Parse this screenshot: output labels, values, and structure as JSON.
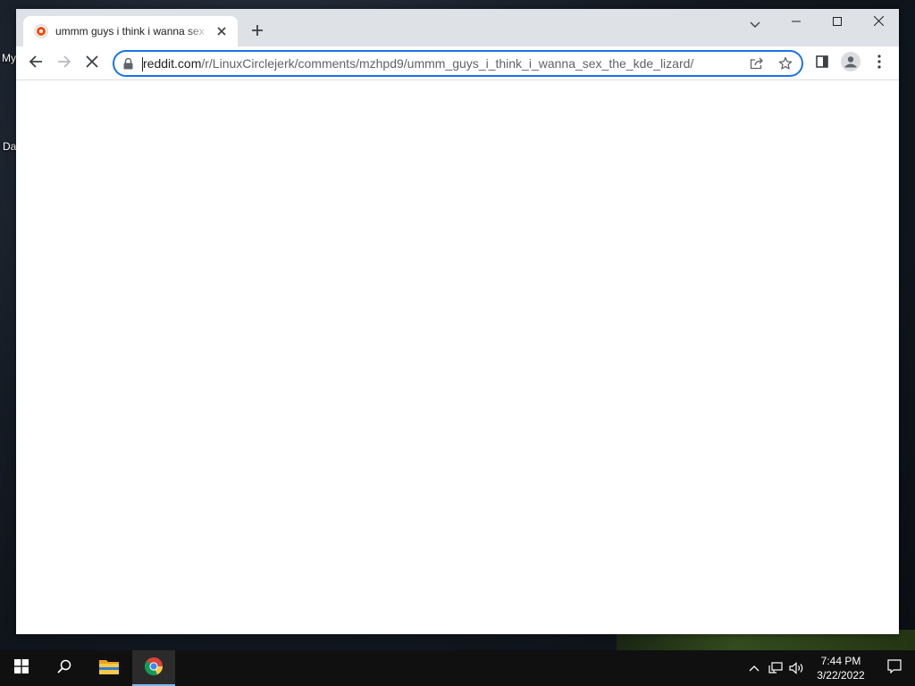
{
  "desktop": {
    "icon_labels": [
      "My",
      "Da"
    ]
  },
  "browser": {
    "tab": {
      "title": "ummm guys i think i wanna sex the kde lizard"
    },
    "address": {
      "host": "reddit.com",
      "path": "/r/LinuxCirclejerk/comments/mzhpd9/ummm_guys_i_think_i_wanna_sex_the_kde_lizard/"
    },
    "icons": {
      "favicon": "reddit-favicon",
      "tab_close": "close-icon",
      "new_tab": "plus-icon",
      "tab_search": "chevron-down-icon",
      "minimize": "minimize-icon",
      "maximize": "maximize-icon",
      "close": "close-icon",
      "back": "back-arrow-icon",
      "forward": "forward-arrow-icon",
      "stop": "stop-loading-icon",
      "lock": "lock-icon",
      "share": "share-icon",
      "bookmark": "star-icon",
      "side_panel": "side-panel-icon",
      "profile": "profile-icon",
      "menu": "kebab-menu-icon"
    }
  },
  "taskbar": {
    "clock_time": "7:44 PM",
    "clock_date": "3/22/2022",
    "icons": [
      "windows-start-icon",
      "search-icon",
      "file-explorer-icon",
      "chrome-icon",
      "chevron-up-icon",
      "network-icon",
      "volume-icon",
      "notification-icon"
    ]
  },
  "colors": {
    "accent": "#1a73e8",
    "tabstrip": "#dee1e6",
    "taskbar": "#101010"
  }
}
